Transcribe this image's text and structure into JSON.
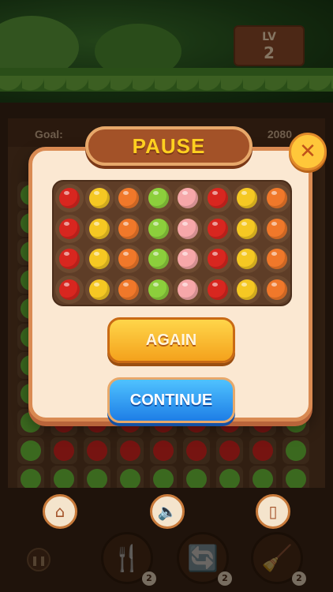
{
  "level": {
    "label": "LV",
    "value": "2"
  },
  "goal": {
    "label": "Goal:",
    "value": "2080"
  },
  "dialog": {
    "title": "PAUSE",
    "close_icon": "close-icon",
    "again_label": "AGAIN",
    "continue_label": "CONTINUE"
  },
  "preview_grid": [
    [
      "tomato",
      "lemon",
      "carrot",
      "apple",
      "peach",
      "tomato",
      "lemon",
      "carrot"
    ],
    [
      "tomato",
      "lemon",
      "carrot",
      "apple",
      "peach",
      "tomato",
      "lemon",
      "carrot"
    ],
    [
      "tomato",
      "lemon",
      "carrot",
      "apple",
      "peach",
      "tomato",
      "lemon",
      "carrot"
    ],
    [
      "tomato",
      "lemon",
      "carrot",
      "apple",
      "peach",
      "tomato",
      "lemon",
      "carrot"
    ]
  ],
  "fruit_colors": {
    "tomato": "#d8261f",
    "lemon": "#f5c823",
    "carrot": "#f0782a",
    "apple": "#8ccf3c",
    "peach": "#f6a7a9"
  },
  "bottom_controls": [
    {
      "name": "home-icon"
    },
    {
      "name": "sound-icon"
    },
    {
      "name": "vibrate-icon"
    }
  ],
  "boosters": [
    {
      "name": "fork-booster-icon",
      "count": "2"
    },
    {
      "name": "swap-booster-icon",
      "count": "2"
    },
    {
      "name": "broom-booster-icon",
      "count": "2"
    }
  ]
}
